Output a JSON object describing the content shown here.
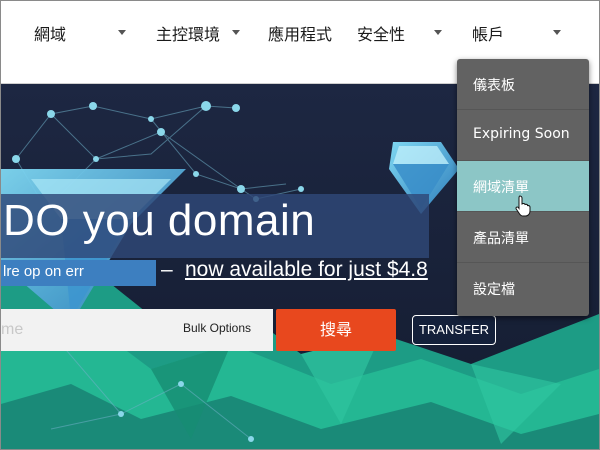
{
  "nav": {
    "items": [
      {
        "label": "網域"
      },
      {
        "label": "主控環境"
      },
      {
        "label": "應用程式"
      },
      {
        "label": "安全性"
      },
      {
        "label": "帳戶"
      }
    ]
  },
  "hero": {
    "headline": "DO you domain",
    "tagline": "lre op on err",
    "promo_dash": "–",
    "promo_link": "now available for just $4.8"
  },
  "search": {
    "placeholder": "me",
    "bulk_label": "Bulk Options",
    "search_label": "搜尋",
    "transfer_label": "TRANSFER"
  },
  "account_menu": {
    "items": [
      {
        "label": "儀表板"
      },
      {
        "label": "Expiring Soon"
      },
      {
        "label": "網域清單"
      },
      {
        "label": "產品清單"
      },
      {
        "label": "設定檔"
      }
    ],
    "active_index": 2
  },
  "colors": {
    "search_button": "#e8481e",
    "menu_background": "#626262",
    "menu_active": "#8cc6c6",
    "hero_background": "#1a2238"
  }
}
